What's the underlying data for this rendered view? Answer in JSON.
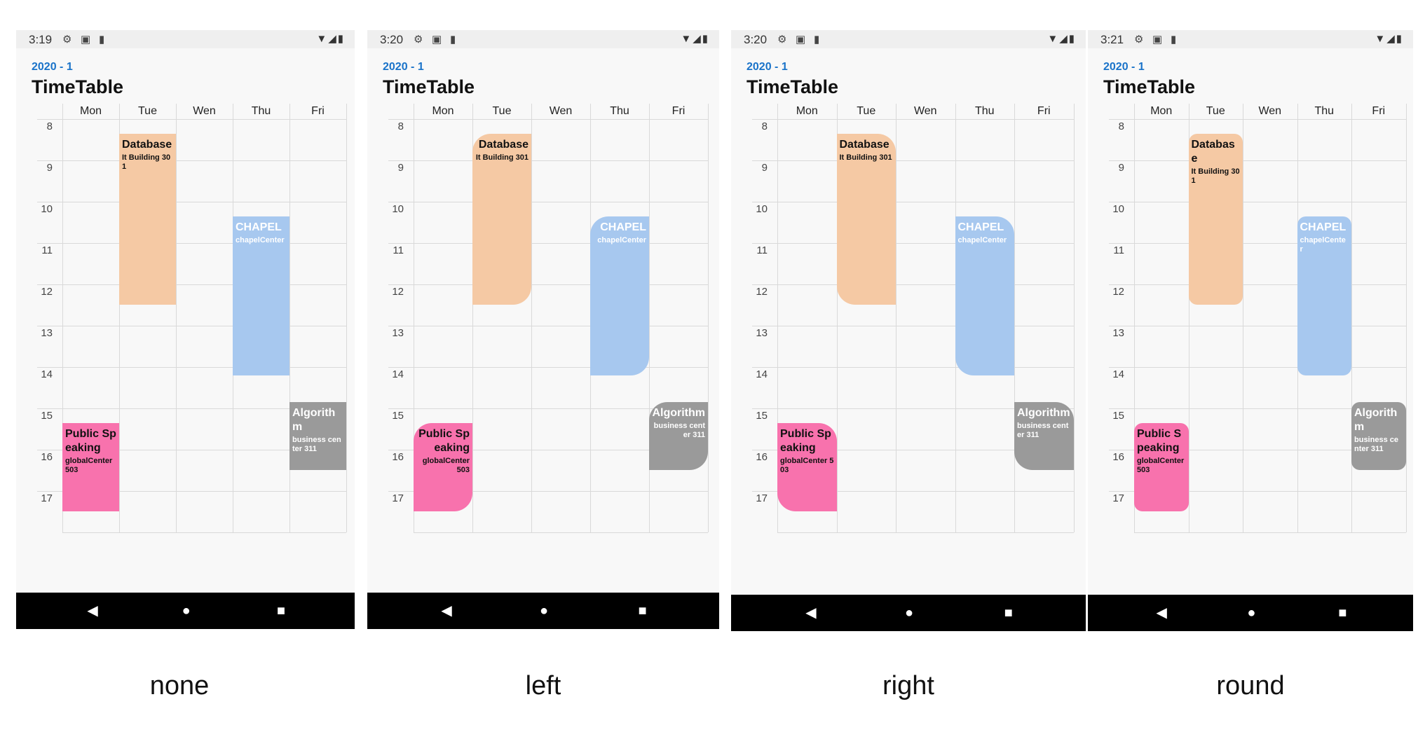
{
  "days": [
    "Mon",
    "Tue",
    "Wen",
    "Thu",
    "Fri"
  ],
  "hours": [
    "8",
    "9",
    "10",
    "11",
    "12",
    "13",
    "14",
    "15",
    "16",
    "17"
  ],
  "courses": [
    {
      "name": "Database",
      "room": "It Building 301",
      "day": 1,
      "start": 8.35,
      "end": 12.5,
      "color": "#f5c9a4",
      "text_color": "#111111"
    },
    {
      "name": "CHAPEL",
      "room": "chapelCenter",
      "day": 3,
      "start": 10.35,
      "end": 14.2,
      "color": "#a7c8ef",
      "text_color": "#ffffff"
    },
    {
      "name": "Public Speaking",
      "room": "globalCenter 503",
      "day": 0,
      "start": 15.35,
      "end": 17.5,
      "color": "#f872ad",
      "text_color": "#111111"
    },
    {
      "name": "Algorithm",
      "room": "business center 311",
      "day": 4,
      "start": 14.85,
      "end": 16.5,
      "color": "#9a9a9a",
      "text_color": "#ffffff"
    }
  ],
  "screens": [
    {
      "time": "3:19",
      "subtitle": "2020 - 1",
      "title": "TimeTable",
      "caption": "none",
      "corner_style": "none",
      "text_align": "left"
    },
    {
      "time": "3:20",
      "subtitle": "2020 - 1",
      "title": "TimeTable",
      "caption": "left",
      "corner_style": "left",
      "text_align": "right"
    },
    {
      "time": "3:20",
      "subtitle": "2020 - 1",
      "title": "TimeTable",
      "caption": "right",
      "corner_style": "right",
      "text_align": "left"
    },
    {
      "time": "3:21",
      "subtitle": "2020 - 1",
      "title": "TimeTable",
      "caption": "round",
      "corner_style": "round",
      "text_align": "left"
    }
  ],
  "status_icons": [
    "gear-icon",
    "text-a-icon",
    "sd-card-icon"
  ],
  "status_right_icons": [
    "wifi-icon",
    "signal-icon",
    "battery-icon"
  ],
  "nav_icons": [
    "back-icon",
    "home-icon",
    "recents-icon"
  ],
  "colors": {
    "accent": "#1a73c9",
    "grid": "#d9d9d9",
    "background": "#f8f8f8"
  }
}
